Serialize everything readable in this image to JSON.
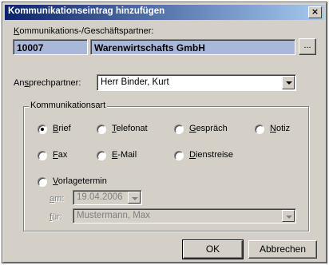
{
  "window": {
    "title": "Kommunikationseintrag hinzufügen",
    "close_symbol": "×"
  },
  "partner": {
    "label": "Kommunikations-/Geschäftspartner:",
    "id": "10007",
    "name": "Warenwirtschafts GmbH",
    "browse_label": "..."
  },
  "contact": {
    "label": "Ansprechpartner:",
    "value": "Herr Binder, Kurt"
  },
  "group": {
    "legend": "Kommunikationsart",
    "options": [
      {
        "label": "Brief",
        "checked": true
      },
      {
        "label": "Telefonat",
        "checked": false
      },
      {
        "label": "Gespräch",
        "checked": false
      },
      {
        "label": "Notiz",
        "checked": false
      },
      {
        "label": "Fax",
        "checked": false
      },
      {
        "label": "E-Mail",
        "checked": false
      },
      {
        "label": "Dienstreise",
        "checked": false
      },
      {
        "label": "Vorlagetermin",
        "checked": false
      }
    ],
    "am_label": "am:",
    "am_value": "19.04.2006",
    "fuer_label": "für:",
    "fuer_value": "Mustermann, Max"
  },
  "buttons": {
    "ok": "OK",
    "cancel": "Abbrechen"
  },
  "colors": {
    "title_start": "#0a246a",
    "title_end": "#a6caf0",
    "face": "#d4d0c8",
    "id_field": "#a9b8d8"
  }
}
